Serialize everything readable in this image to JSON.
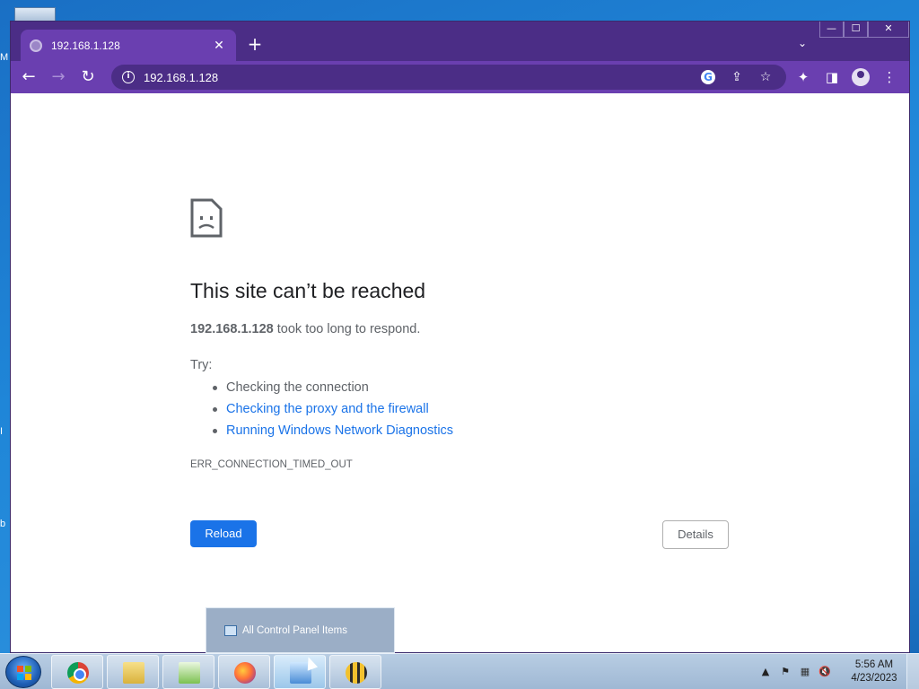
{
  "desktop": {
    "edge_letters": [
      "M",
      "I",
      "b"
    ]
  },
  "browser": {
    "tab": {
      "title": "192.168.1.128",
      "close_glyph": "✕"
    },
    "new_tab_glyph": "+",
    "tab_search_glyph": "⌄",
    "caption": {
      "minimize": "—",
      "maximize": "☐",
      "close": "✕"
    },
    "toolbar": {
      "back_glyph": "←",
      "forward_glyph": "→",
      "reload_glyph": "↻",
      "url": "192.168.1.128",
      "info_glyph": "i",
      "google_glyph": "G",
      "share_glyph": "⇪",
      "star_glyph": "☆",
      "extensions_glyph": "✦",
      "sidepanel_glyph": "◨",
      "menu_glyph": "⋮"
    },
    "colors": {
      "frame": "#4b2d86",
      "toolbar": "#6a3fb0",
      "link": "#1a73e8",
      "primary_button": "#1a73e8"
    }
  },
  "error_page": {
    "title": "This site can’t be reached",
    "host": "192.168.1.128",
    "summary_rest": " took too long to respond.",
    "try_label": "Try:",
    "suggestions": [
      {
        "text": "Checking the connection",
        "link": false
      },
      {
        "text": "Checking the proxy and the firewall",
        "link": true
      },
      {
        "text": "Running Windows Network Diagnostics",
        "link": true
      }
    ],
    "error_code": "ERR_CONNECTION_TIMED_OUT",
    "reload_label": "Reload",
    "details_label": "Details"
  },
  "thumbnail_popup": {
    "label": "All Control Panel Items",
    "icon": "control-panel-icon"
  },
  "taskbar": {
    "apps": [
      {
        "name": "chrome",
        "icon": "chrome-icon"
      },
      {
        "name": "file-explorer",
        "icon": "folder-icon"
      },
      {
        "name": "notepad-plus-plus",
        "icon": "notepad-icon"
      },
      {
        "name": "firefox",
        "icon": "firefox-icon"
      },
      {
        "name": "control-panel",
        "icon": "control-panel-icon",
        "active": true
      },
      {
        "name": "bee-app",
        "icon": "bee-icon"
      }
    ],
    "tray": {
      "expand_glyph": "▲",
      "flag_glyph": "⚑",
      "network_glyph": "▦",
      "volume_glyph": "🔇"
    },
    "clock": {
      "time": "5:56 AM",
      "date": "4/23/2023"
    }
  }
}
